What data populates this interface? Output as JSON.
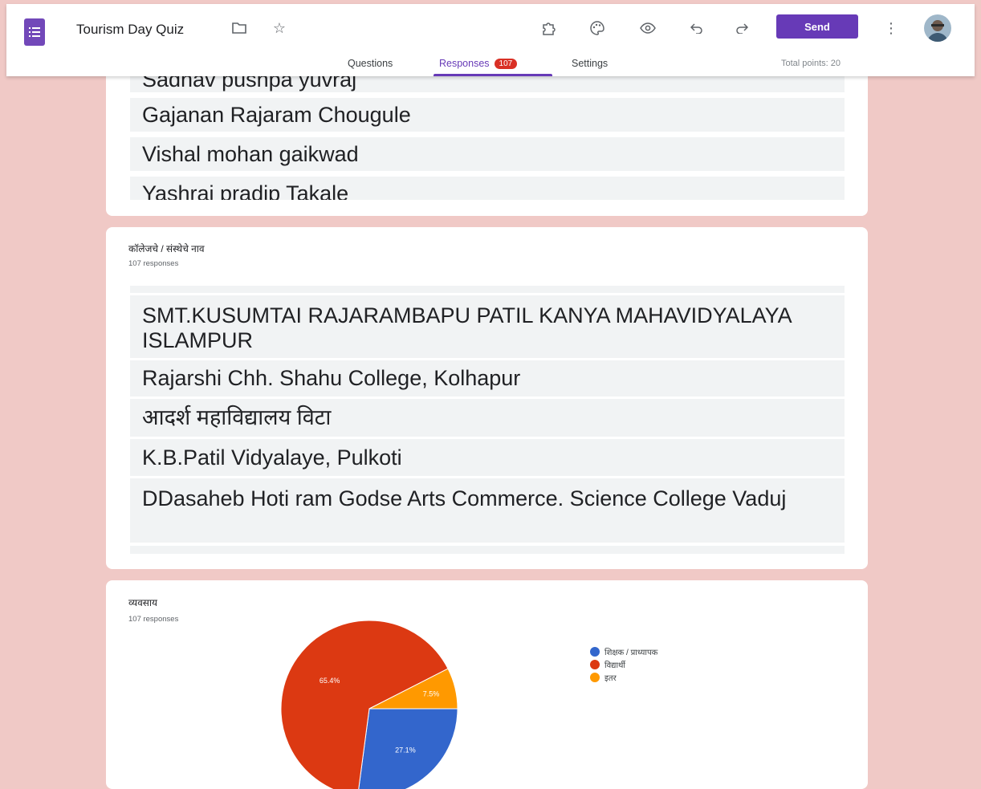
{
  "header": {
    "title": "Tourism Day Quiz",
    "icons": [
      "forms-logo-icon",
      "folder-icon",
      "star-icon",
      "addon-puzzle-icon",
      "palette-icon",
      "preview-eye-icon",
      "undo-icon",
      "redo-icon",
      "more-vert-icon"
    ],
    "send_label": "Send",
    "tabs": [
      {
        "label": "Questions"
      },
      {
        "label": "Responses",
        "badge": "107"
      },
      {
        "label": "Settings"
      }
    ],
    "total_points": "Total points: 20"
  },
  "names_card": {
    "partial_top": "Sadhav pushpa yuvraj",
    "rows": [
      "Gajanan Rajaram Chougule",
      "Vishal mohan gaikwad",
      "Yashraj pradip Takale"
    ]
  },
  "college_card": {
    "title": "कॉलेजचे / संस्थेचे नाव",
    "count": "107 responses",
    "rows": [
      "SMT.KUSUMTAI RAJARAMBAPU PATIL KANYA MAHAVIDYALAYA ISLAMPUR",
      "Rajarshi Chh. Shahu College, Kolhapur",
      "आदर्श महाविद्यालय विटा",
      "K.B.Patil Vidyalaye, Pulkoti",
      "DDasaheb Hoti ram Godse Arts Commerce. Science College Vaduj"
    ]
  },
  "occupation_card": {
    "title": "व्यवसाय",
    "count": "107 responses"
  },
  "colors": {
    "accent": "#673ab7",
    "badge": "#d93025",
    "page_bg": "#f0c9c6"
  },
  "chart_data": {
    "type": "pie",
    "title": "व्यवसाय",
    "categories": [
      "शिक्षक / प्राध्यापक",
      "विद्यार्थी",
      "इतर"
    ],
    "values": [
      27.1,
      65.4,
      7.5
    ],
    "labels": [
      "27.1%",
      "65.4%",
      "7.5%"
    ],
    "colors": [
      "#3366cc",
      "#dc3912",
      "#ff9900"
    ],
    "legend": "right"
  }
}
